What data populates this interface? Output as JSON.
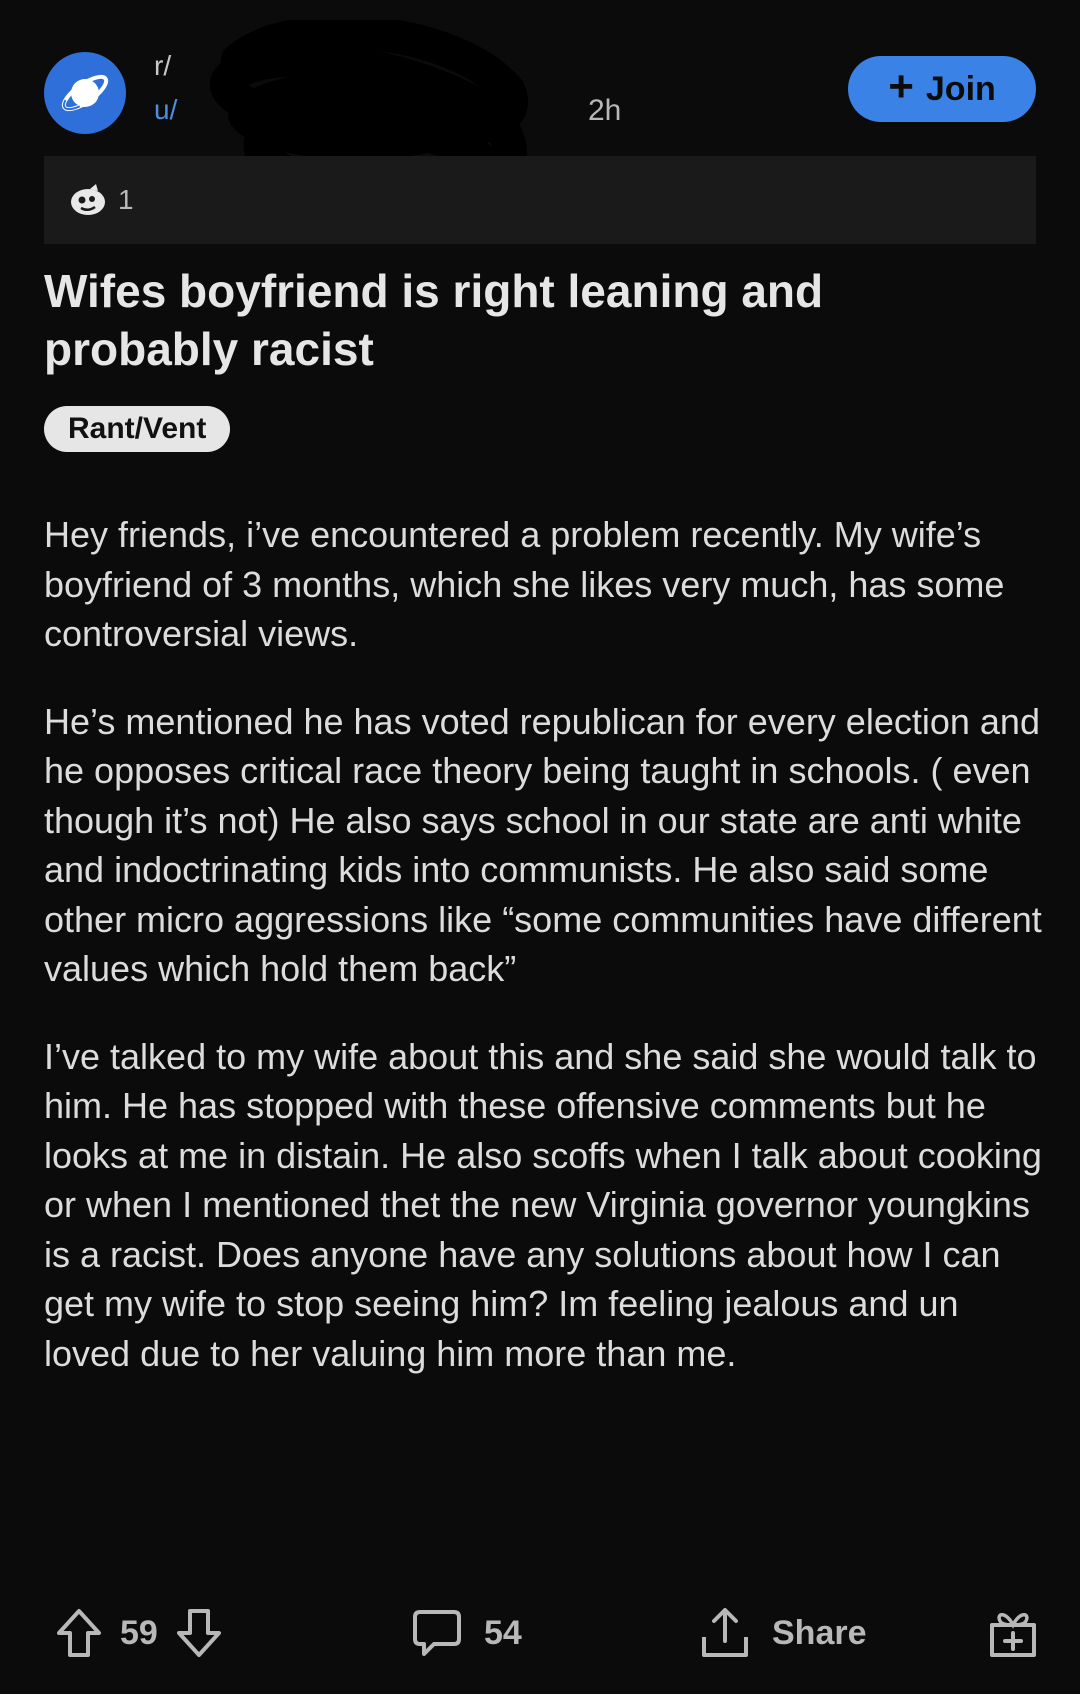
{
  "post_header": {
    "subreddit_prefix": "r/",
    "username_prefix": "u/",
    "time_ago": "2h",
    "join_label": "Join",
    "join_icon": "plus-icon",
    "avatar_icon": "planet-icon",
    "redaction_color": "#000000"
  },
  "awards": {
    "icon": "award-icon",
    "count": "1"
  },
  "post": {
    "title": "Wifes boyfriend is right leaning and probably racist",
    "flair": "Rant/Vent",
    "paragraphs": [
      "Hey friends, i’ve encountered a problem recently. My wife’s boyfriend of 3 months, which she likes very much, has some controversial views.",
      "He’s mentioned he has voted republican for every election and he opposes  critical race theory being taught in schools. ( even though it’s not) He also says school in our state are anti white and indoctrinating kids into communists. He also said some other micro aggressions like “some communities have different values which hold them back”",
      "I’ve talked to my wife about this and she said she would talk to him. He has stopped with these offensive comments but he looks at me in distain. He also scoffs when I talk about cooking or when I mentioned thet the new Virginia governor youngkins is a racist. Does anyone have any solutions about how I can get my wife to stop seeing him? Im feeling jealous and un loved due to her valuing him more than me."
    ]
  },
  "actions": {
    "upvote_icon": "upvote-arrow-icon",
    "vote_count": "59",
    "downvote_icon": "downvote-arrow-icon",
    "comment_icon": "comment-bubble-icon",
    "comment_count": "54",
    "share_icon": "share-icon",
    "share_label": "Share",
    "give_award_icon": "gift-icon"
  },
  "colors": {
    "background": "#0b0b0c",
    "accent_blue": "#3a82e6",
    "text_primary": "#e6e6e6",
    "text_muted": "#b8b8b8"
  }
}
